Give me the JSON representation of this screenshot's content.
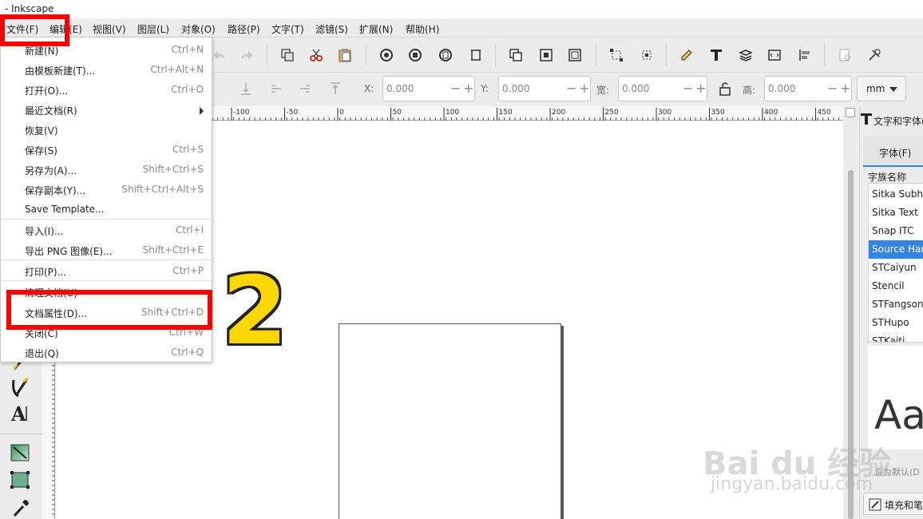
{
  "window": {
    "title": "- Inkscape"
  },
  "menubar": [
    {
      "label": "文件(F)"
    },
    {
      "label": "编辑(E)"
    },
    {
      "label": "视图(V)"
    },
    {
      "label": "图层(L)"
    },
    {
      "label": "对象(O)"
    },
    {
      "label": "路径(P)"
    },
    {
      "label": "文字(T)"
    },
    {
      "label": "滤镜(S)"
    },
    {
      "label": "扩展(N)"
    },
    {
      "label": "帮助(H)"
    }
  ],
  "file_menu": {
    "items": [
      {
        "label": "新建(N)",
        "shortcut": "Ctrl+N"
      },
      {
        "label": "由模板新建(T)...",
        "shortcut": "Ctrl+Alt+N"
      },
      {
        "label": "打开(O)...",
        "shortcut": "Ctrl+O"
      },
      {
        "label": "最近文档(R)",
        "shortcut": ""
      },
      {
        "label": "恢复(V)",
        "shortcut": ""
      },
      {
        "label": "保存(S)",
        "shortcut": "Ctrl+S"
      },
      {
        "label": "另存为(A)...",
        "shortcut": "Shift+Ctrl+S"
      },
      {
        "label": "保存副本(Y)...",
        "shortcut": "Shift+Ctrl+Alt+S"
      },
      {
        "label": "Save Template...",
        "shortcut": ""
      },
      {
        "label": "导入(I)...",
        "shortcut": "Ctrl+I"
      },
      {
        "label": "导出 PNG 图像(E)...",
        "shortcut": "Shift+Ctrl+E"
      },
      {
        "label": "打印(P)...",
        "shortcut": "Ctrl+P"
      },
      {
        "label": "清理文档(U)",
        "shortcut": ""
      },
      {
        "label": "文档属性(D)...",
        "shortcut": "Shift+Ctrl+D"
      },
      {
        "label": "关闭(C)",
        "shortcut": "Ctrl+W"
      },
      {
        "label": "退出(Q)",
        "shortcut": "Ctrl+Q"
      }
    ]
  },
  "controls": {
    "x_label": "X:",
    "x_value": "0.000",
    "y_label": "Y:",
    "y_value": "0.000",
    "w_label": "宽:",
    "w_value": "0.000",
    "h_label": "高:",
    "h_value": "0.000",
    "unit": "mm"
  },
  "ruler": {
    "ticks": [
      "-100",
      "-50",
      "0",
      "50",
      "100",
      "150",
      "200",
      "250",
      "300",
      "350",
      "400",
      "450"
    ]
  },
  "dock": {
    "header": "文字和字体(",
    "tab": "字体(F)",
    "column_header": "字族名称",
    "fonts": [
      "Sitka Subhe",
      "Sitka Text",
      "Snap ITC",
      "Source Han",
      "STCaiyun",
      "Stencil",
      "STFangsong",
      "STHupo",
      "STKaiti"
    ],
    "selected_font_index": 3,
    "preview_text": "Aa",
    "set_default": "设为默认(D",
    "fill_button": "填充和笔刷"
  },
  "annotation": {
    "step_number": "2"
  },
  "watermark": {
    "brand": "Bai du 经验",
    "url": "jingyan.baidu.com"
  },
  "colors": {
    "highlight": "#ff0000",
    "selection": "#3584e4",
    "step_number": "#ffd700"
  }
}
